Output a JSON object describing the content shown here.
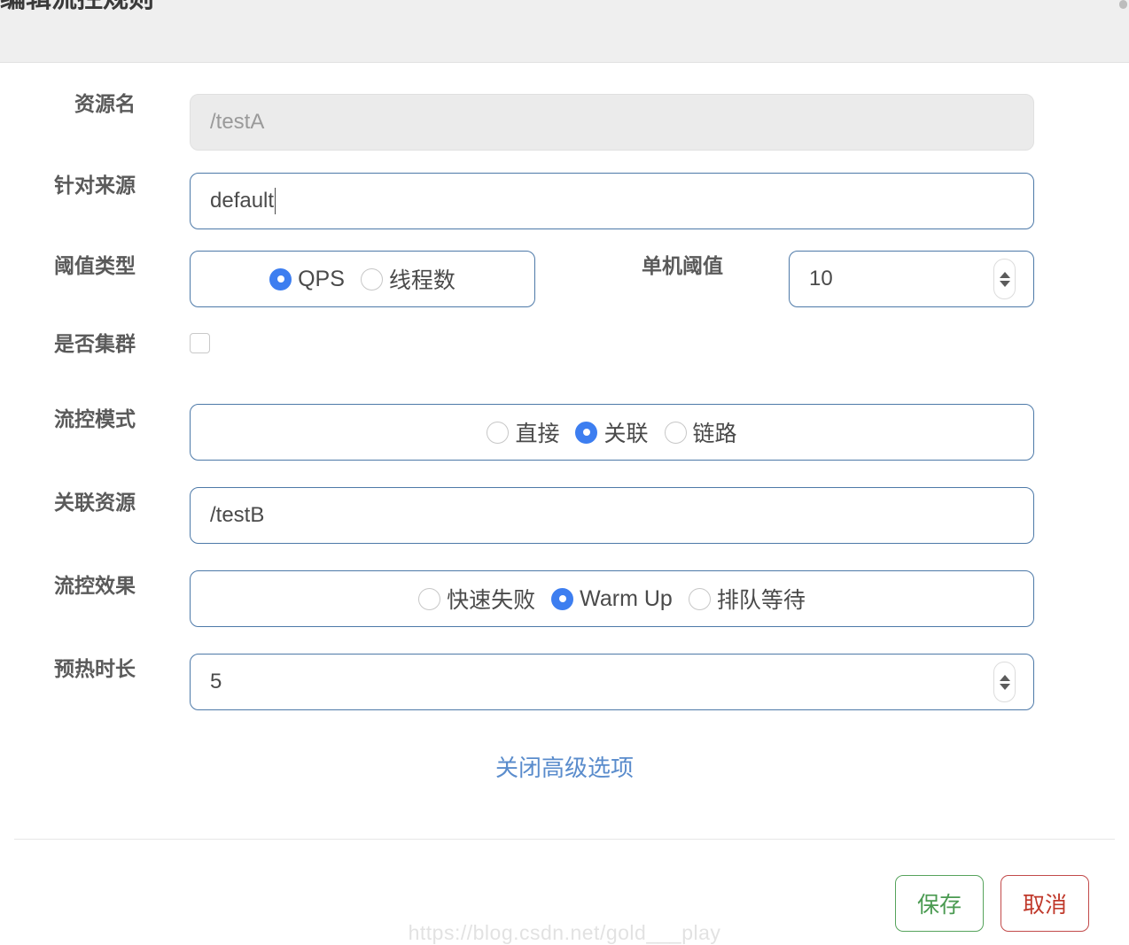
{
  "dialog": {
    "title": "编辑流控规则",
    "scrollbar": "vertical-scrollbar-thumb"
  },
  "colors": {
    "accent_blue": "#3d7ef0",
    "link_blue": "#5a8ccc",
    "border_blue": "#4d79a8",
    "save_green": "#4a9a51",
    "cancel_red": "#c0392b",
    "header_bg": "#efefef",
    "disabled_bg": "#ebebeb"
  },
  "form": {
    "resource_name": {
      "label": "资源名",
      "value": "/testA",
      "disabled": true
    },
    "origin": {
      "label": "针对来源",
      "value": "default",
      "focused": true
    },
    "threshold_type": {
      "label": "阈值类型",
      "options": [
        {
          "label": "QPS",
          "checked": true
        },
        {
          "label": "线程数",
          "checked": false
        }
      ]
    },
    "single_threshold": {
      "label": "单机阈值",
      "value": "10"
    },
    "is_cluster": {
      "label": "是否集群",
      "checked": false
    },
    "flow_mode": {
      "label": "流控模式",
      "options": [
        {
          "label": "直接",
          "checked": false
        },
        {
          "label": "关联",
          "checked": true
        },
        {
          "label": "链路",
          "checked": false
        }
      ]
    },
    "ref_resource": {
      "label": "关联资源",
      "value": "/testB"
    },
    "flow_effect": {
      "label": "流控效果",
      "options": [
        {
          "label": "快速失败",
          "checked": false
        },
        {
          "label": "Warm Up",
          "checked": true
        },
        {
          "label": "排队等待",
          "checked": false
        }
      ]
    },
    "warmup_duration": {
      "label": "预热时长",
      "value": "5"
    }
  },
  "advanced_link": {
    "label": "关闭高级选项"
  },
  "footer": {
    "save_label": "保存",
    "cancel_label": "取消"
  },
  "watermark": {
    "text": "https://blog.csdn.net/gold___play"
  }
}
